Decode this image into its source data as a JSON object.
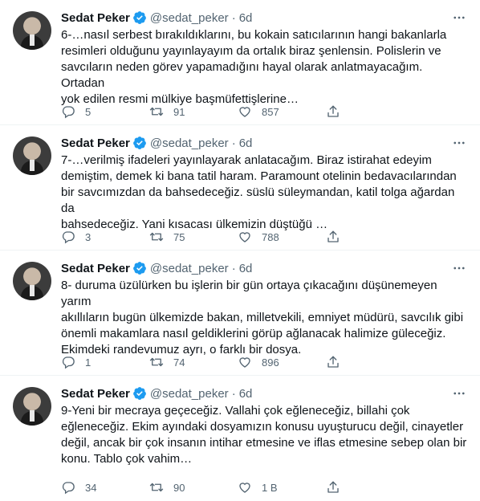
{
  "tweets": [
    {
      "name": "Sedat Peker",
      "handle": "@sedat_peker",
      "separator": "·",
      "time": "6d",
      "text": "6-…nasıl serbest bırakıldıklarını, bu kokain satıcılarının hangi bakanlarla\nresimleri olduğunu yayınlayayım da ortalık biraz şenlensin. Polislerin ve\nsavcıların neden görev yapamadığını hayal olarak anlatmayacağım. Ortadan\nyok edilen resmi mülkiye başmüfettişlerine…",
      "replies": "5",
      "retweets": "91",
      "likes": "857"
    },
    {
      "name": "Sedat Peker",
      "handle": "@sedat_peker",
      "separator": "·",
      "time": "6d",
      "text": "7-…verilmiş ifadeleri yayınlayarak anlatacağım. Biraz istirahat edeyim\ndemiştim, demek ki bana tatil haram. Paramount otelinin bedavacılarından\nbir savcımızdan da bahsedeceğiz. süslü süleymandan, katil tolga ağardan da\nbahsedeceğiz. Yani kısacası ülkemizin düştüğü …",
      "replies": "3",
      "retweets": "75",
      "likes": "788"
    },
    {
      "name": "Sedat Peker",
      "handle": "@sedat_peker",
      "separator": "·",
      "time": "6d",
      "text": "8- duruma üzülürken bu işlerin bir gün ortaya çıkacağını düşünemeyen yarım\nakıllıların bugün ülkemizde bakan, milletvekili, emniyet müdürü, savcılık gibi\nönemli makamlara nasıl geldiklerini görüp ağlanacak halimize güleceğiz.\nEkimdeki randevumuz ayrı, o farklı bir dosya.",
      "replies": "1",
      "retweets": "74",
      "likes": "896"
    },
    {
      "name": "Sedat Peker",
      "handle": "@sedat_peker",
      "separator": "·",
      "time": "6d",
      "text": "9-Yeni bir mecraya geçeceğiz. Vallahi çok eğleneceğiz, billahi çok\neğleneceğiz. Ekim ayındaki dosyamızın konusu uyuşturucu değil, cinayetler\ndeğil, ancak bir çok insanın intihar etmesine ve iflas etmesine sebep olan bir\nkonu. Tablo çok vahim…",
      "replies": "34",
      "retweets": "90",
      "likes": "1 B"
    }
  ],
  "icons": {
    "verified": "verified-badge-icon",
    "more": "more-icon",
    "reply": "reply-icon",
    "retweet": "retweet-icon",
    "like": "heart-icon",
    "share": "share-icon"
  },
  "colors": {
    "verified": "#1d9bf0",
    "muted": "#536471",
    "text": "#0f1419"
  }
}
